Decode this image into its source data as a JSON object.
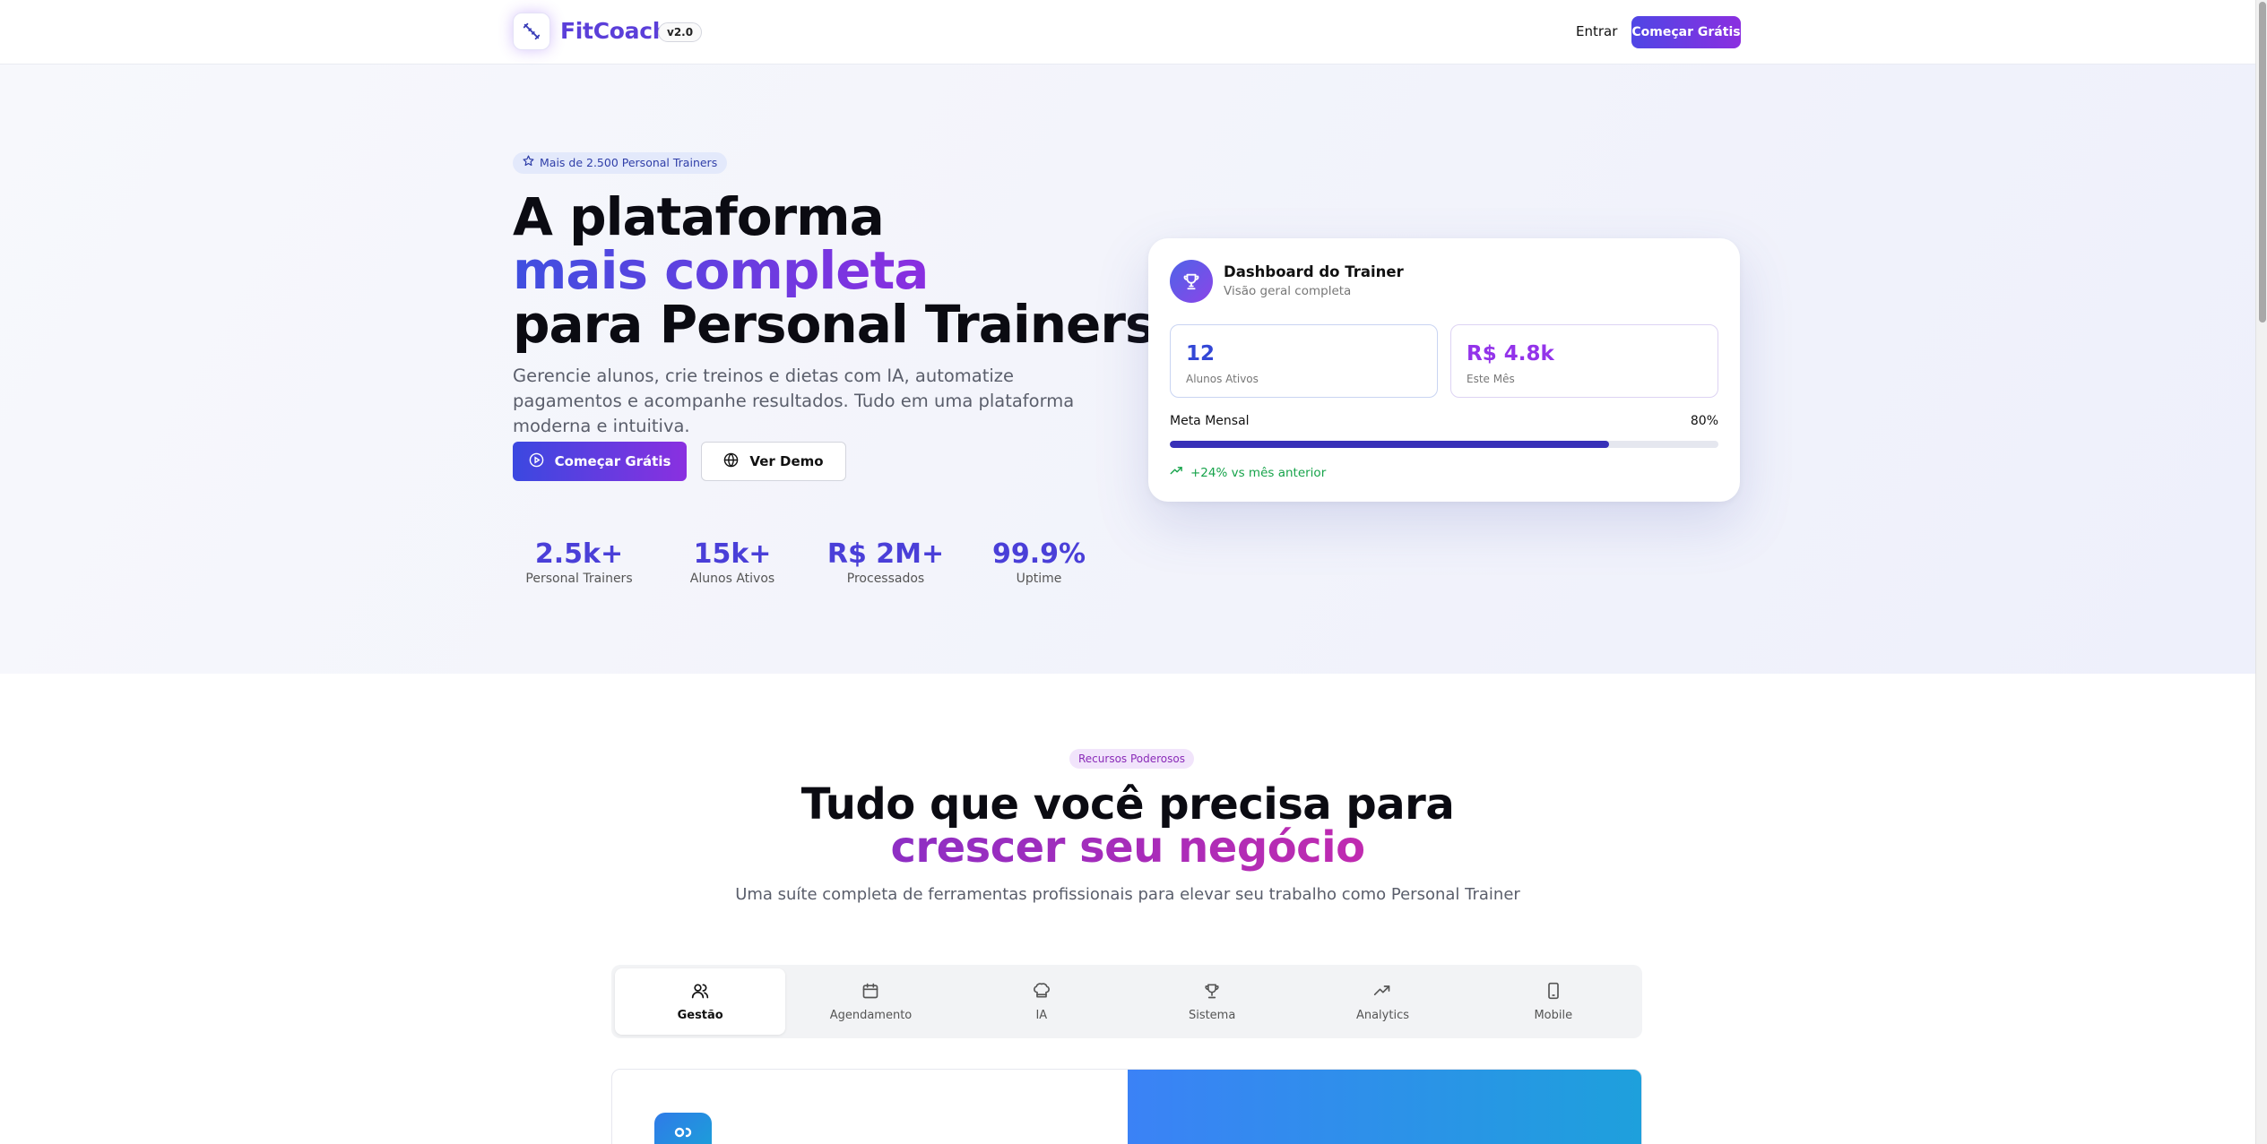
{
  "nav": {
    "brand": "FitCoach",
    "version": "v2.0",
    "login": "Entrar",
    "cta": "Começar Grátis"
  },
  "hero": {
    "badge": "Mais de 2.500 Personal Trainers",
    "title_line1": "A plataforma",
    "title_line2": "mais completa",
    "title_line3": "para Personal Trainers",
    "subtitle": "Gerencie alunos, crie treinos e dietas com IA, automatize pagamentos e acompanhe resultados. Tudo em uma plataforma moderna e intuitiva.",
    "primary_button": "Começar Grátis",
    "secondary_button": "Ver Demo",
    "stats": [
      {
        "value": "2.5k+",
        "label": "Personal Trainers"
      },
      {
        "value": "15k+",
        "label": "Alunos Ativos"
      },
      {
        "value": "R$ 2M+",
        "label": "Processados"
      },
      {
        "value": "99.9%",
        "label": "Uptime"
      }
    ]
  },
  "dashboard": {
    "title": "Dashboard do Trainer",
    "subtitle": "Visão geral completa",
    "metric1": {
      "value": "12",
      "label": "Alunos Ativos"
    },
    "metric2": {
      "value": "R$ 4.8k",
      "label": "Este Mês"
    },
    "goal_label": "Meta Mensal",
    "goal_percent": "80%",
    "goal_fraction": 0.8,
    "trend": "+24% vs mês anterior"
  },
  "features": {
    "badge": "Recursos Poderosos",
    "title_line1": "Tudo que você precisa para",
    "title_line2": "crescer seu negócio",
    "subtitle": "Uma suíte completa de ferramentas profissionais para elevar seu trabalho como Personal Trainer",
    "tabs": [
      {
        "label": "Gestão",
        "icon": "users-icon",
        "active": true
      },
      {
        "label": "Agendamento",
        "icon": "calendar-icon"
      },
      {
        "label": "IA",
        "icon": "chef-hat-icon"
      },
      {
        "label": "Sistema",
        "icon": "trophy-icon"
      },
      {
        "label": "Analytics",
        "icon": "trending-up-icon"
      },
      {
        "label": "Mobile",
        "icon": "smartphone-icon"
      }
    ]
  },
  "colors": {
    "brand": "#5b3fd9",
    "gradient_start": "#3b48e0",
    "gradient_end": "#8a30e0",
    "success": "#16a34a"
  }
}
